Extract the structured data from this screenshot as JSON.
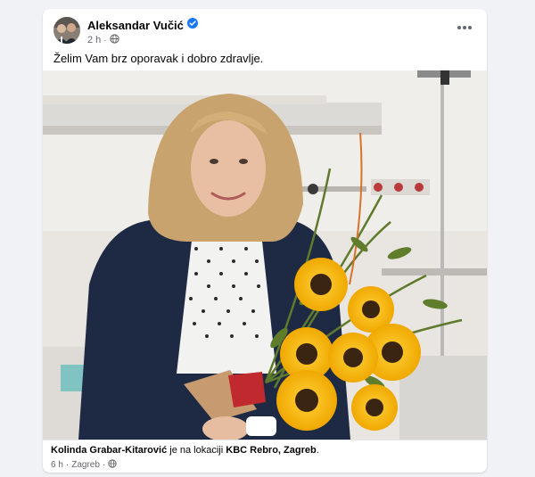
{
  "post": {
    "author": "Aleksandar Vučić",
    "time": "2 h",
    "separator": "·",
    "text": "Želim Vam brz oporavak i dobro zdravlje."
  },
  "shared_card": {
    "person": "Kolinda Grabar-Kitarović",
    "connector": " je na lokaciji ",
    "place": "KBC Rebro, Zagreb",
    "end": ".",
    "time": "6 h",
    "separator": "·",
    "city": "Zagreb"
  },
  "colors": {
    "background": "#f0f2f5",
    "card": "#ffffff",
    "verified": "#1877f2",
    "secondary_text": "#65676b",
    "primary_text": "#050505"
  },
  "icons": {
    "verified": "verified-badge-icon",
    "audience": "globe-icon",
    "more": "more-options-icon"
  }
}
